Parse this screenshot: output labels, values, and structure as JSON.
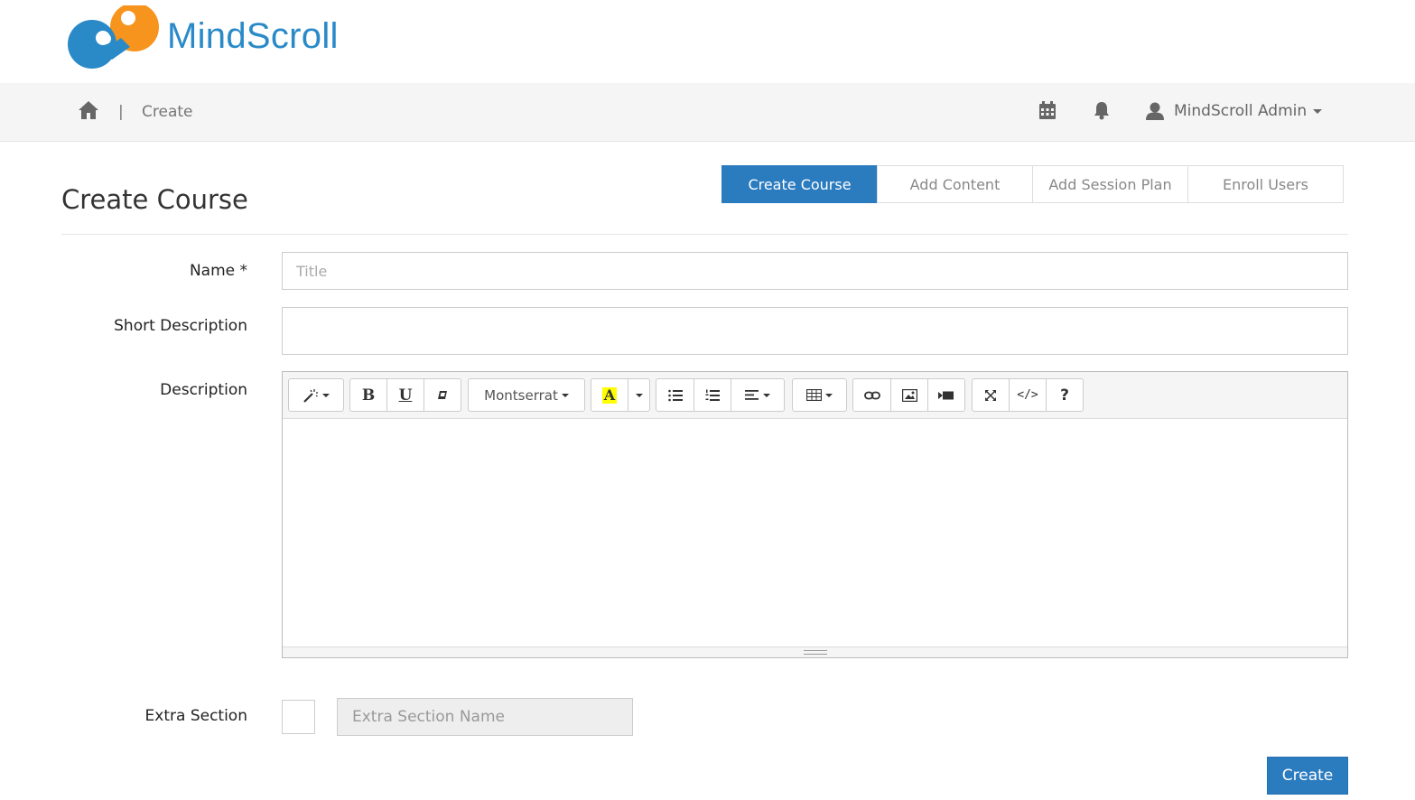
{
  "brand": {
    "name": "MindScroll",
    "colors": {
      "blue": "#2a8ac8",
      "orange": "#f7941d"
    }
  },
  "navbar": {
    "home_icon": "home-icon",
    "separator": "|",
    "breadcrumb": "Create",
    "icons": [
      "calendar-icon",
      "bell-icon",
      "user-icon"
    ],
    "user_name": "MindScroll Admin"
  },
  "page": {
    "title": "Create Course"
  },
  "steps": [
    {
      "label": "Create Course",
      "active": true
    },
    {
      "label": "Add Content",
      "active": false
    },
    {
      "label": "Add Session Plan",
      "active": false
    },
    {
      "label": "Enroll Users",
      "active": false
    }
  ],
  "form": {
    "name_label": "Name *",
    "name_placeholder": "Title",
    "name_value": "",
    "short_desc_label": "Short Description",
    "short_desc_value": "",
    "description_label": "Description",
    "extra_section_label": "Extra Section",
    "extra_section_placeholder": "Extra Section Name",
    "extra_section_checked": false,
    "submit_label": "Create"
  },
  "editor": {
    "font_family": "Montserrat",
    "toolbar_icons": [
      "magic-wand-icon",
      "bold-icon",
      "underline-icon",
      "eraser-icon",
      "font-family-dropdown",
      "text-color-icon",
      "unordered-list-icon",
      "ordered-list-icon",
      "align-icon",
      "table-icon",
      "link-icon",
      "picture-icon",
      "video-icon",
      "fullscreen-icon",
      "code-view-icon",
      "help-icon"
    ],
    "bold": "B",
    "underline": "U",
    "text_color": "A",
    "code": "</>",
    "help": "?",
    "content": ""
  },
  "accent_color": "#2b7bbf"
}
